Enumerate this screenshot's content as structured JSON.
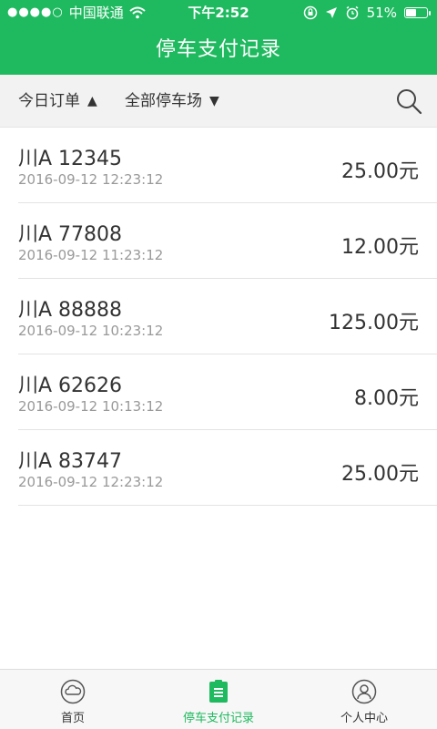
{
  "status_bar": {
    "carrier": "中国联通",
    "time": "下午2:52",
    "battery": "51%",
    "battery_level": 0.51
  },
  "header": {
    "title": "停车支付记录"
  },
  "filters": {
    "date_filter": "今日订单",
    "date_arrow": "▲",
    "lot_filter": "全部停车场",
    "lot_arrow": "▼",
    "search_icon": "search-icon"
  },
  "records": [
    {
      "plate": "川A 12345",
      "time": "2016-09-12 12:23:12",
      "amount": "25.00元"
    },
    {
      "plate": "川A 77808",
      "time": "2016-09-12 11:23:12",
      "amount": "12.00元"
    },
    {
      "plate": "川A 88888",
      "time": "2016-09-12 10:23:12",
      "amount": "125.00元"
    },
    {
      "plate": "川A 62626",
      "time": "2016-09-12 10:13:12",
      "amount": "8.00元"
    },
    {
      "plate": "川A 83747",
      "time": "2016-09-12 12:23:12",
      "amount": "25.00元"
    }
  ],
  "tabs": [
    {
      "label": "首页",
      "icon": "cloud-home-icon",
      "active": false
    },
    {
      "label": "停车支付记录",
      "icon": "clipboard-list-icon",
      "active": true
    },
    {
      "label": "个人中心",
      "icon": "user-profile-icon",
      "active": false
    }
  ],
  "colors": {
    "brand_green": "#1fba5f",
    "filter_bg": "#f2f2f2",
    "secondary_text": "#999999"
  }
}
